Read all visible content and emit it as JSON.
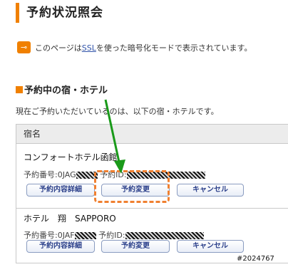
{
  "header": {
    "title": "予約状況照会"
  },
  "ssl_notice": {
    "icon": "key-icon",
    "text_before": "このページは",
    "link": "SSL",
    "text_after": "を使った暗号化モードで表示されています。"
  },
  "section": {
    "title": "予約中の宿・ホテル"
  },
  "intro": "現在ご予約いただいているのは、以下の宿・ホテルです。",
  "table": {
    "header": "宿名",
    "rows": [
      {
        "name": "コンフォートホテル函館",
        "reservation_label": "予約番号:0JAG",
        "id_label": "予約ID:",
        "buttons": [
          "予約内容詳細",
          "予約変更",
          "キャンセル"
        ]
      },
      {
        "name": "ホテル　翔　SAPPORO",
        "reservation_label": "予約番号:0JAF",
        "id_label": "予約ID:",
        "buttons": [
          "予約内容詳細",
          "予約変更",
          "キャンセル"
        ]
      }
    ]
  },
  "annotation": {
    "highlight_color": "#f08030",
    "arrow_color": "#1a9a1a"
  },
  "watermark": "#2024767"
}
